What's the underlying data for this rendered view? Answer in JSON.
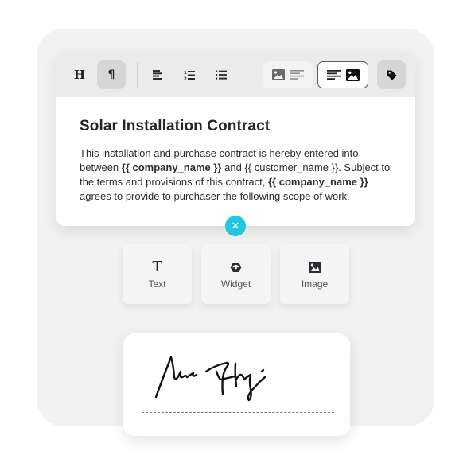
{
  "toolbar": {
    "buttons": [
      {
        "name": "heading",
        "icon": "heading-icon",
        "glyph": "H",
        "active": false
      },
      {
        "name": "paragraph",
        "icon": "paragraph-icon",
        "glyph": "¶",
        "active": true
      },
      {
        "name": "align-left",
        "icon": "align-left-icon",
        "active": false
      },
      {
        "name": "ordered-list",
        "icon": "ordered-list-icon",
        "active": false
      },
      {
        "name": "bullet-list",
        "icon": "bullet-list-icon",
        "active": false
      }
    ],
    "layout_options": [
      {
        "name": "image-left-text-right",
        "selected": false
      },
      {
        "name": "text-left-image-right",
        "selected": true
      }
    ],
    "tag_button": {
      "icon": "tag-icon",
      "active": true
    }
  },
  "document": {
    "title": "Solar Installation Contract",
    "paragraph": {
      "p1": "This installation and purchase contract is hereby entered into between ",
      "var1": "{{ company_name }}",
      "p2": " and {{ customer_name }}. Subject to the terms and provisions of this contract, ",
      "var2": "{{ company_name }}",
      "p3": " agrees to provide to purchaser the following scope of work."
    }
  },
  "close_button": {
    "icon": "close-icon",
    "glyph": "✕",
    "color": "#22c7dd"
  },
  "insert_options": [
    {
      "label": "Text",
      "icon": "text-icon"
    },
    {
      "label": "Widget",
      "icon": "widget-icon"
    },
    {
      "label": "Image",
      "icon": "image-icon"
    }
  ],
  "signature": {
    "icon": "signature-drawing"
  }
}
